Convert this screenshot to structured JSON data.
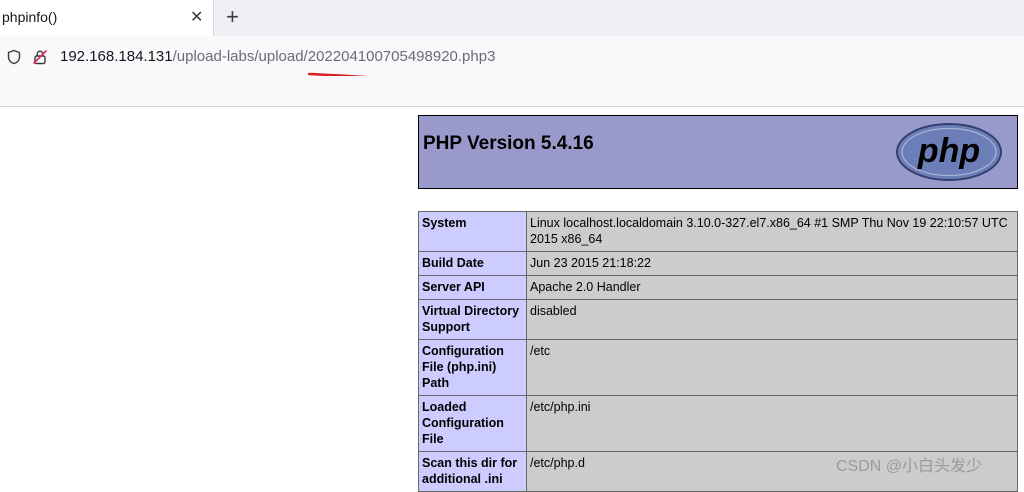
{
  "tab": {
    "title": "phpinfo()",
    "close_label": "✕",
    "new_tab_label": "+"
  },
  "address": {
    "host": "192.168.184.131",
    "path": "/upload-labs/upload/202204100705498920.php3"
  },
  "header": {
    "version": "PHP Version 5.4.16",
    "logo_text": "php"
  },
  "rows": [
    {
      "key": "System",
      "value": "Linux localhost.localdomain 3.10.0-327.el7.x86_64 #1 SMP Thu Nov 19 22:10:57 UTC 2015 x86_64"
    },
    {
      "key": "Build Date",
      "value": "Jun 23 2015 21:18:22"
    },
    {
      "key": "Server API",
      "value": "Apache 2.0 Handler"
    },
    {
      "key": "Virtual Directory Support",
      "value": "disabled"
    },
    {
      "key": "Configuration File (php.ini) Path",
      "value": "/etc"
    },
    {
      "key": "Loaded Configuration File",
      "value": "/etc/php.ini"
    },
    {
      "key": "Scan this dir for additional .ini",
      "value": "/etc/php.d"
    }
  ],
  "watermark": "CSDN @小白头发少",
  "colors": {
    "header_bg": "#9999cc",
    "key_bg": "#ccccff",
    "value_bg": "#cccccc",
    "annotation": "#d81e1e"
  }
}
